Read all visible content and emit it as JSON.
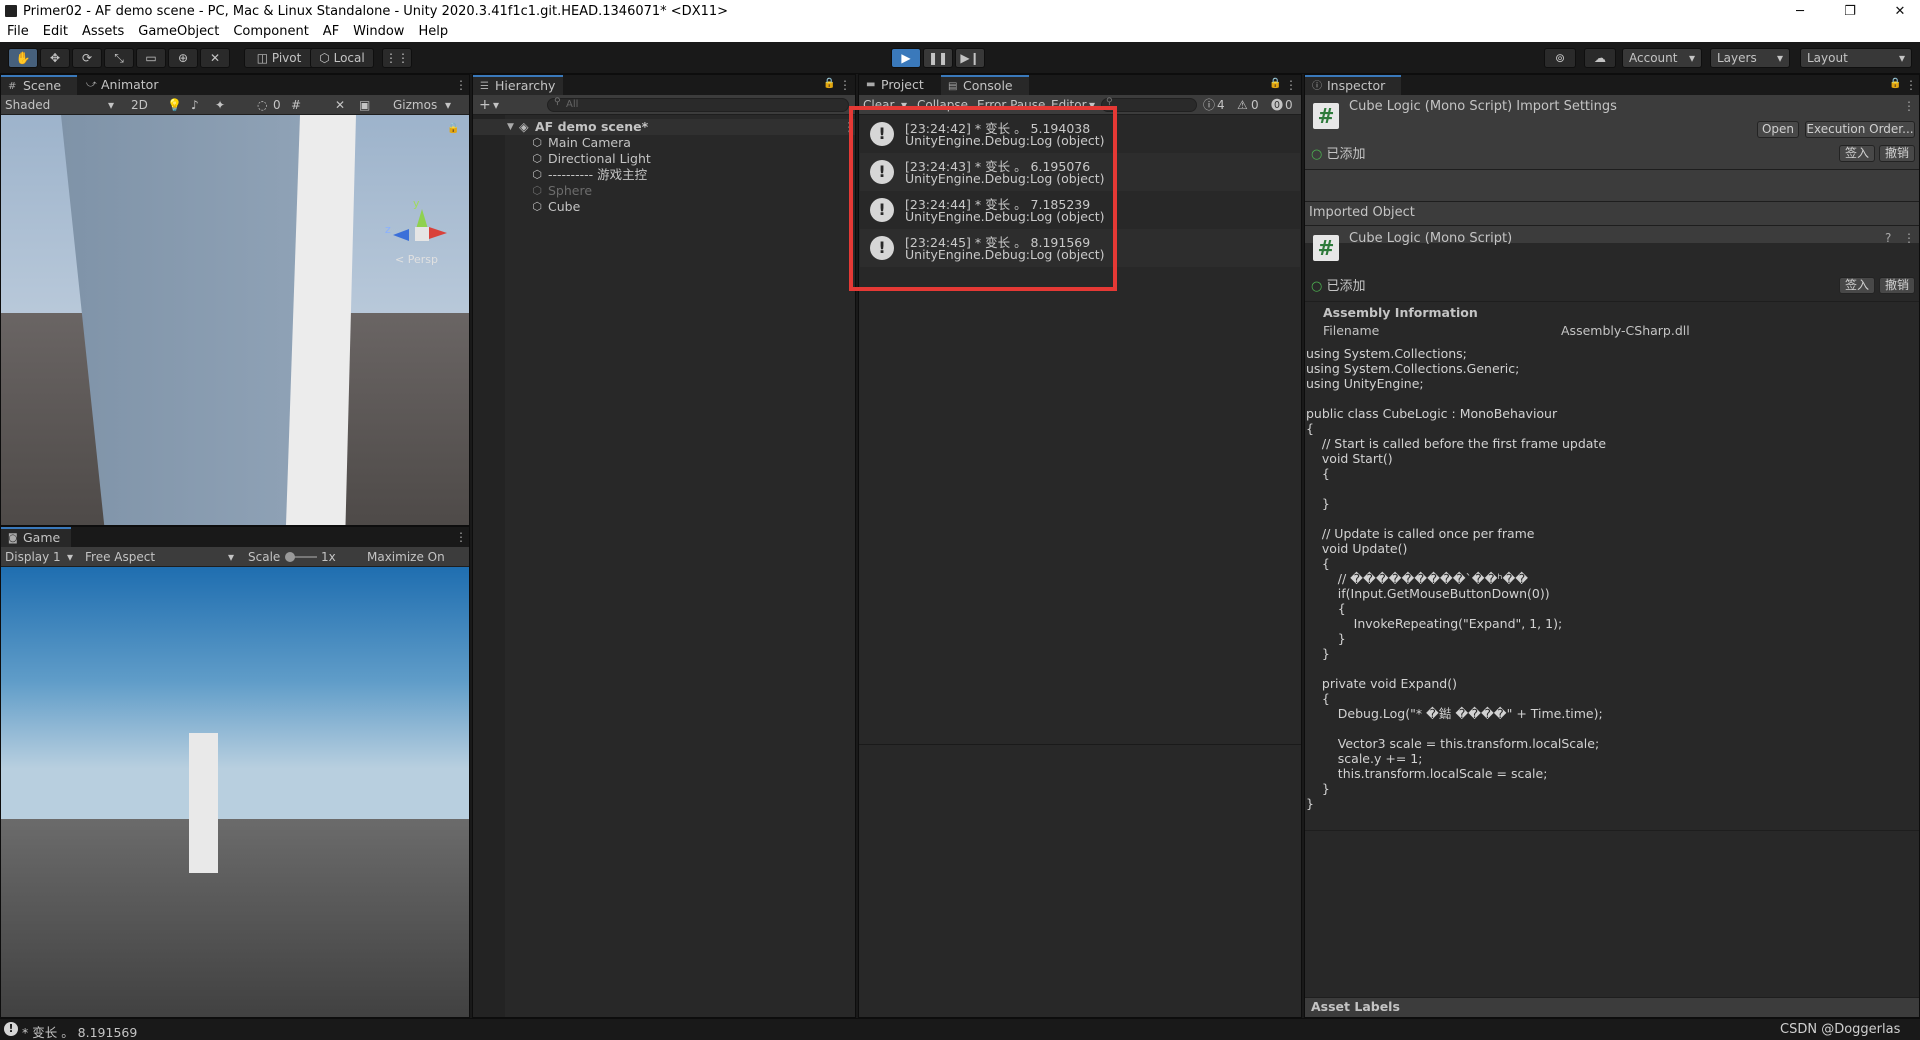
{
  "window": {
    "title": "Primer02 - AF demo scene - PC, Mac & Linux Standalone - Unity 2020.3.41f1c1.git.HEAD.1346071* <DX11>",
    "minimize": "─",
    "restore": "❐",
    "close": "✕"
  },
  "menu": [
    "File",
    "Edit",
    "Assets",
    "GameObject",
    "Component",
    "AF",
    "Window",
    "Help"
  ],
  "toolbar": {
    "pivot": "Pivot",
    "local": "Local",
    "play_icon": "play-icon",
    "pause_icon": "pause-icon",
    "step_icon": "step-icon",
    "account": "Account",
    "layers": "Layers",
    "layout": "Layout",
    "accent": "#3a79bb"
  },
  "scene": {
    "tabs": [
      "Scene",
      "Animator"
    ],
    "shading": "Shaded",
    "mode_2d": "2D",
    "hidden_count": "0",
    "gizmos": "Gizmos",
    "axis_y": "y",
    "axis_z": "z",
    "persp": "< Persp"
  },
  "game": {
    "tab": "Game",
    "display": "Display 1",
    "aspect": "Free Aspect",
    "scale_label": "Scale",
    "scale_value": "1x",
    "maximize": "Maximize On Play"
  },
  "hierarchy": {
    "tab": "Hierarchy",
    "add": "+",
    "search_placeholder": "All",
    "scene_name": "AF demo scene*",
    "items": [
      "Main Camera",
      "Directional Light",
      "---------- 游戏主控",
      "Sphere",
      "Cube"
    ]
  },
  "console": {
    "tabs": [
      "Project",
      "Console"
    ],
    "toolbar": [
      "Clear",
      "Collapse",
      "Error Pause",
      "Editor"
    ],
    "counts": {
      "info": "4",
      "warn": "0",
      "error": "0"
    },
    "highlight_color": "#e53935",
    "logs": [
      {
        "line1": "[23:24:42] * 变长 。 5.194038",
        "line2": "UnityEngine.Debug:Log (object)"
      },
      {
        "line1": "[23:24:43] * 变长 。 6.195076",
        "line2": "UnityEngine.Debug:Log (object)"
      },
      {
        "line1": "[23:24:44] * 变长 。 7.185239",
        "line2": "UnityEngine.Debug:Log (object)"
      },
      {
        "line1": "[23:24:45] * 变长 。 8.191569",
        "line2": "UnityEngine.Debug:Log (object)"
      }
    ]
  },
  "inspector": {
    "tab": "Inspector",
    "header_title": "Cube Logic (Mono Script) Import Settings",
    "open": "Open",
    "exec_order": "Execution Order...",
    "added": "已添加",
    "checkin": "签入",
    "revert": "撤销",
    "imported_object": "Imported Object",
    "object_title": "Cube Logic (Mono Script)",
    "assembly_info": "Assembly Information",
    "filename_label": "Filename",
    "filename_value": "Assembly-CSharp.dll",
    "code": "using System.Collections;\nusing System.Collections.Generic;\nusing UnityEngine;\n\npublic class CubeLogic : MonoBehaviour\n{\n    // Start is called before the first frame update\n    void Start()\n    {\n\n    }\n\n    // Update is called once per frame\n    void Update()\n    {\n        // ���������`��ʰ��\n        if(Input.GetMouseButtonDown(0))\n        {\n            InvokeRepeating(\"Expand\", 1, 1);\n        }\n    }\n\n    private void Expand()\n    {\n        Debug.Log(\"* �鐑 ����\" + Time.time);\n\n        Vector3 scale = this.transform.localScale;\n        scale.y += 1;\n        this.transform.localScale = scale;\n    }\n}",
    "asset_labels": "Asset Labels"
  },
  "status": {
    "message": "* 变长 。 8.191569",
    "watermark": "CSDN @Doggerlas"
  }
}
